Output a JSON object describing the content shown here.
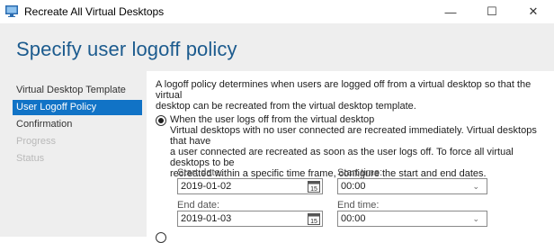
{
  "window": {
    "title": "Recreate All Virtual Desktops",
    "minimize": "—",
    "maximize": "☐",
    "close": "✕"
  },
  "page": {
    "title": "Specify user logoff policy"
  },
  "nav": {
    "items": [
      {
        "label": "Virtual Desktop Template",
        "state": "done"
      },
      {
        "label": "User Logoff Policy",
        "state": "active"
      },
      {
        "label": "Confirmation",
        "state": "pending"
      },
      {
        "label": "Progress",
        "state": "disabled"
      },
      {
        "label": "Status",
        "state": "disabled"
      }
    ]
  },
  "content": {
    "intro_line1": "A logoff policy determines when users are logged off from a virtual desktop so that the virtual",
    "intro_line2": "desktop can be recreated from the virtual desktop template.",
    "option1": {
      "label": "When the user logs off from the virtual desktop",
      "selected": true,
      "desc_line1": "Virtual desktops with no user connected are recreated immediately. Virtual desktops that have",
      "desc_line2": "a user connected are recreated as soon as the user logs off. To force all virtual desktops to be",
      "desc_line3": "recreated within a specific time frame, configure the start and end dates."
    },
    "start_date_label": "Start date:",
    "start_date_value": "2019-01-02",
    "start_time_label": "Start time:",
    "start_time_value": "00:00",
    "end_date_label": "End date:",
    "end_date_value": "2019-01-03",
    "end_time_label": "End time:",
    "end_time_value": "00:00",
    "calendar_day": "15"
  },
  "colors": {
    "accent": "#1173c6",
    "title": "#1c5b8e",
    "panel": "#eeeeee"
  }
}
